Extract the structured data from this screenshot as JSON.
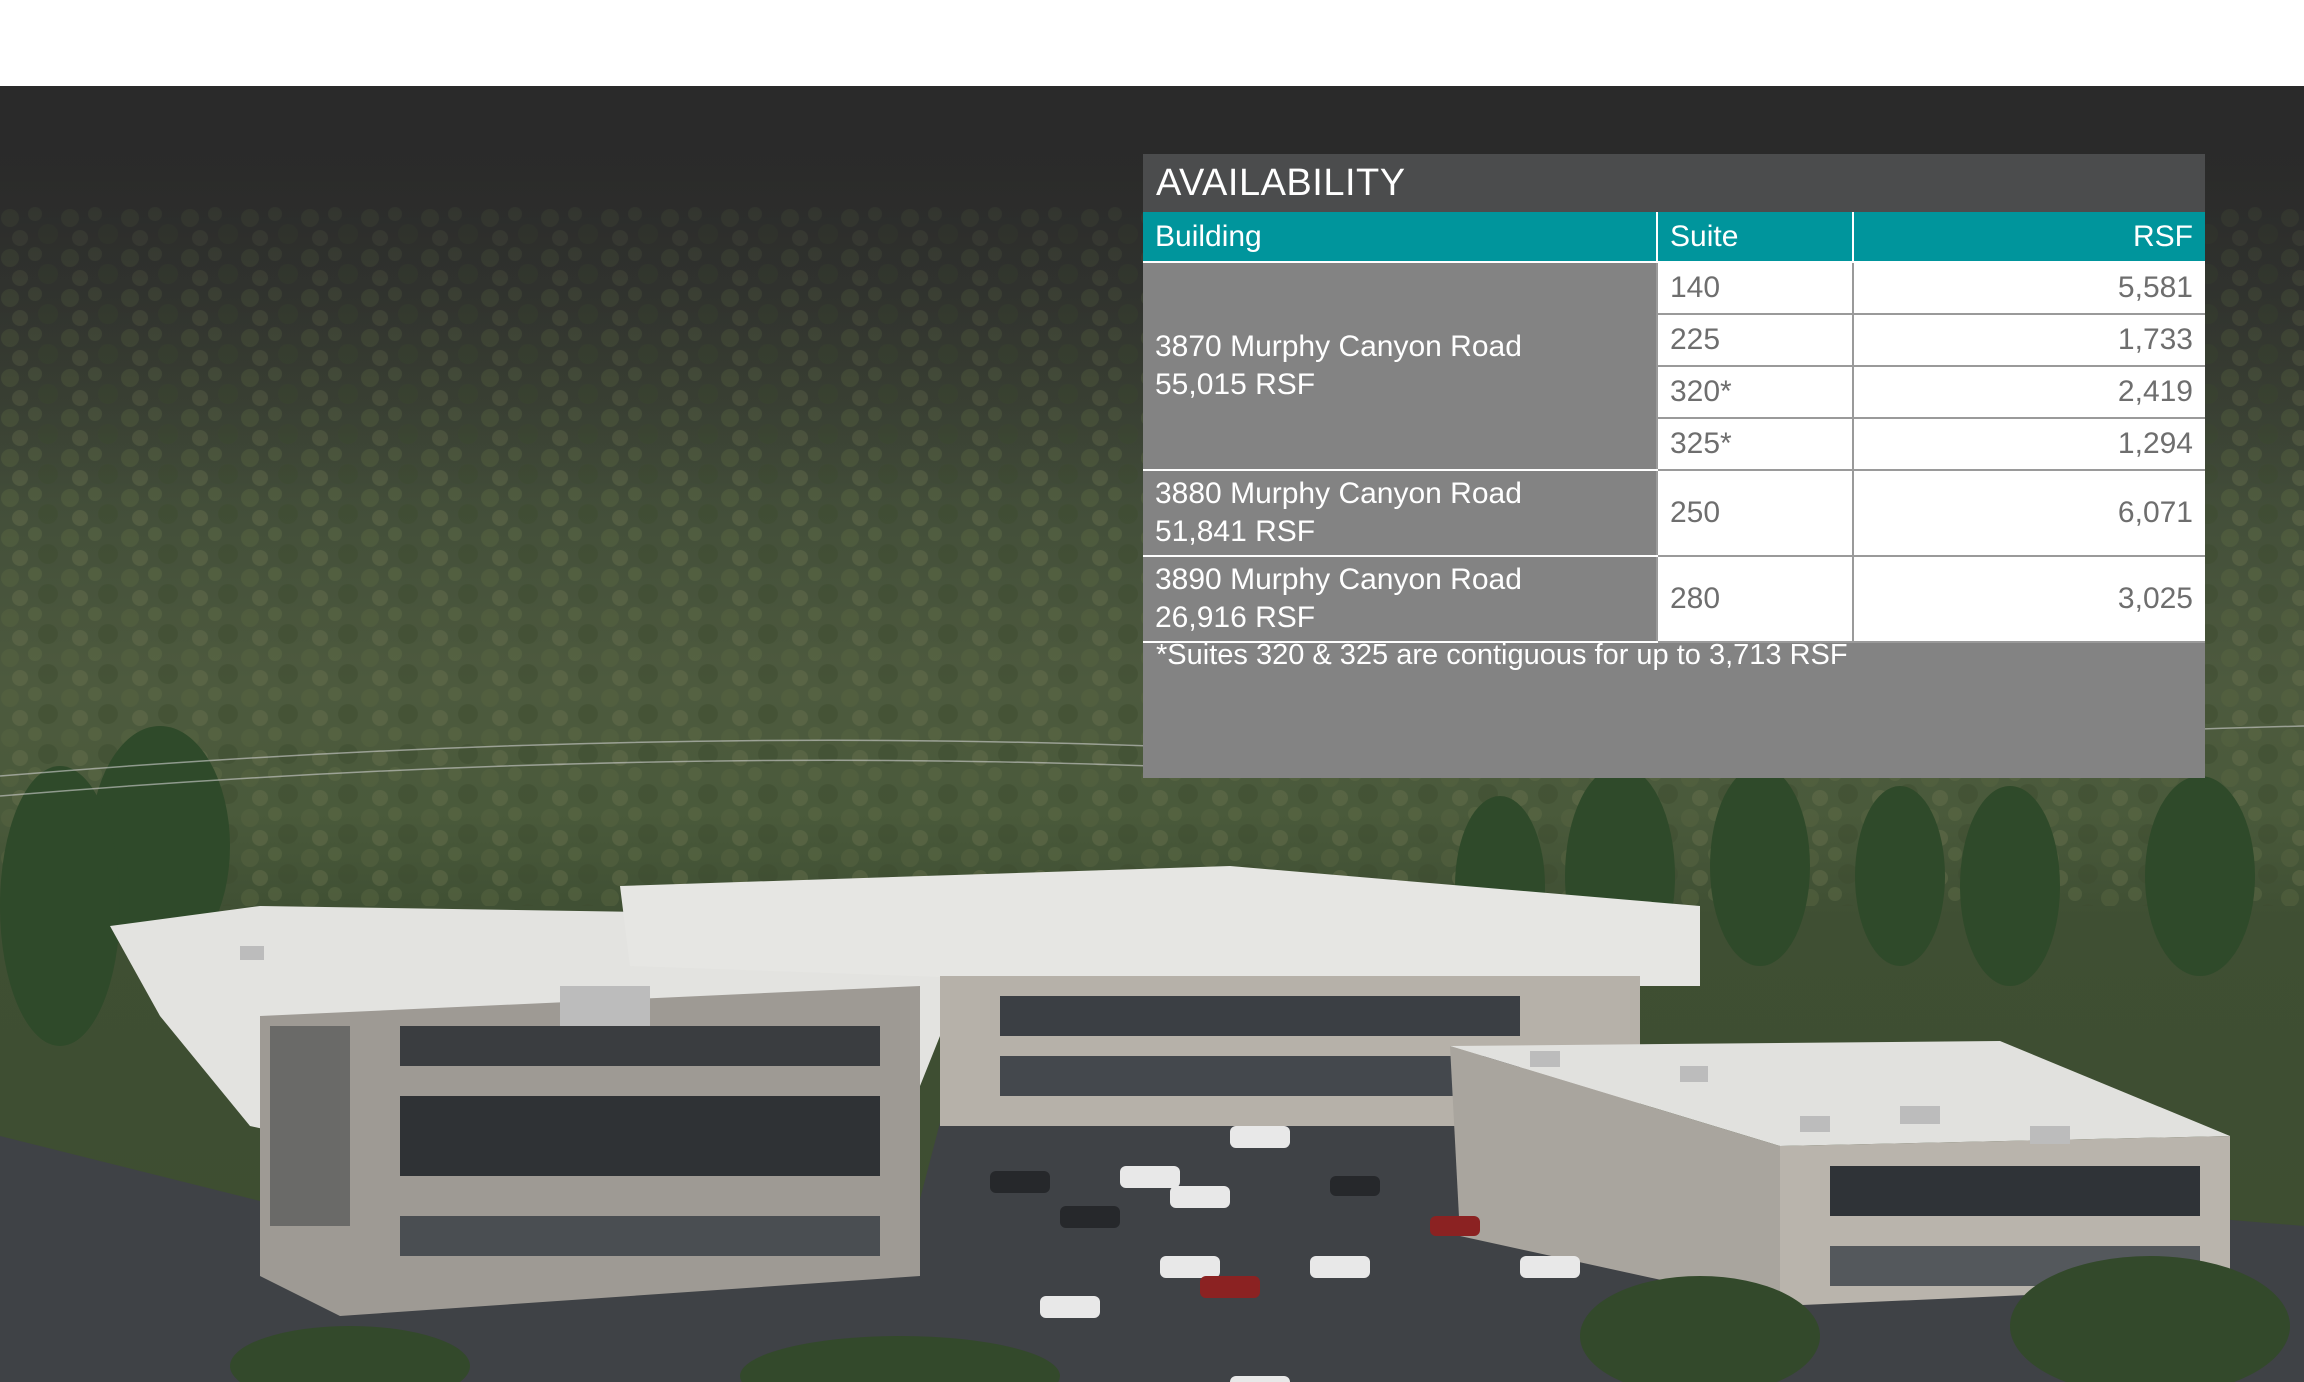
{
  "availability": {
    "title": "AVAILABILITY",
    "headers": {
      "building": "Building",
      "suite": "Suite",
      "rsf": "RSF"
    },
    "buildings": [
      {
        "name": "3870 Murphy Canyon Road",
        "size": "55,015 RSF",
        "suites": [
          {
            "suite": "140",
            "rsf": "5,581"
          },
          {
            "suite": "225",
            "rsf": "1,733"
          },
          {
            "suite": "320*",
            "rsf": "2,419"
          },
          {
            "suite": "325*",
            "rsf": "1,294"
          }
        ]
      },
      {
        "name": "3880 Murphy Canyon Road",
        "size": "51,841 RSF",
        "suites": [
          {
            "suite": "250",
            "rsf": "6,071"
          }
        ]
      },
      {
        "name": "3890 Murphy Canyon Road",
        "size": "26,916 RSF",
        "suites": [
          {
            "suite": "280",
            "rsf": "3,025"
          }
        ]
      }
    ],
    "footnote": "*Suites 320 & 325 are contiguous for up to 3,713 RSF"
  },
  "colors": {
    "header_teal": "#00959c",
    "title_bar": "#4b4c4d",
    "panel_gray": "#838383"
  }
}
